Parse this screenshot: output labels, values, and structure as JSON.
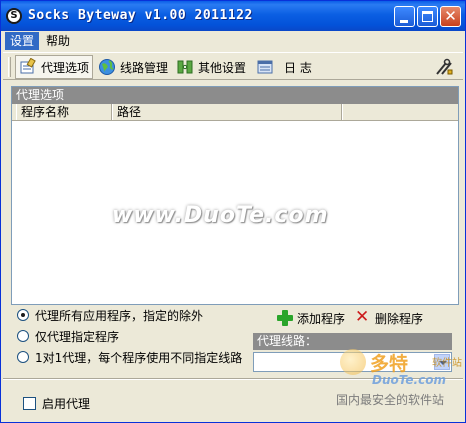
{
  "window": {
    "title": "Socks Byteway v1.00 2011122"
  },
  "menu": {
    "items": [
      "设置",
      "帮助"
    ],
    "active": 0
  },
  "toolbar": {
    "proxy_options": "代理选项",
    "route_management": "线路管理",
    "other_settings": "其他设置",
    "log": "日  志"
  },
  "proxy_panel": {
    "header": "代理选项",
    "columns": [
      "程序名称",
      "路径"
    ],
    "rows": [],
    "watermark": "www.DuoTe.com"
  },
  "proxy_mode": {
    "options": [
      "代理所有应用程序，指定的除外",
      "仅代理指定程序",
      "1对1代理，每个程序使用不同指定线路"
    ],
    "selected": 0
  },
  "actions": {
    "add_program": "添加程序",
    "delete_program": "删除程序"
  },
  "route": {
    "label": "代理线路：",
    "selected_value": ""
  },
  "enable_proxy": {
    "label": "启用代理",
    "checked": false
  },
  "site_watermark": {
    "logo": "多特",
    "logo_sub": "软件站",
    "domain": "DuoTe.com",
    "tagline": "国内最安全的软件站"
  },
  "colors": {
    "titlebar": "#0352d9",
    "window_bg": "#ece9d8",
    "panel_header": "#8c8c8c",
    "menu_active": "#316ac5",
    "add_icon": "#2aa52a",
    "delete_icon": "#cc1a1a"
  }
}
